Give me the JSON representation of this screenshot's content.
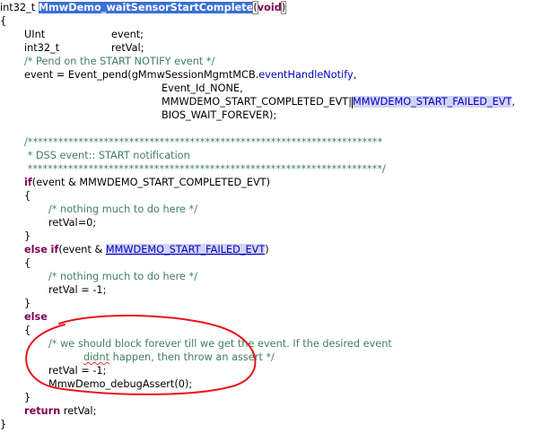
{
  "code": {
    "l01_type": "int32_t ",
    "l01_fname": "MmwDemo_waitSensorStartComplete",
    "l01_open": "(",
    "l01_void": "void",
    "l01_close": ")",
    "l02": "{",
    "l03_type": "UInt",
    "l03_var": "event;",
    "l04_type": "int32_t",
    "l04_var": "retVal;",
    "l05": "/* Pend on the START NOTIFY event */",
    "l06_a": "event = Event_pend(gMmwSessionMgmtMCB.",
    "l06_field": "eventHandleNotify",
    "l06_b": ",",
    "l07": "Event_Id_NONE,",
    "l08_a": "MMWDEMO_START_COMPLETED_EVT|",
    "l08_hl": "MMWDEMO_START_FAILED_EVT",
    "l08_b": ",",
    "l09": "BIOS_WAIT_FOREVER);",
    "l11": "/**********************************************************************",
    "l12": " * DSS event:: START notification",
    "l13": " **********************************************************************/",
    "l14_kw": "if",
    "l14_rest": "(event & MMWDEMO_START_COMPLETED_EVT)",
    "l15": "{",
    "l16": "/* nothing much to do here */",
    "l17": "retVal=0;",
    "l18": "}",
    "l19_kw1": "else",
    "l19_kw2": "if",
    "l19_a": "(event & ",
    "l19_hl": "MMWDEMO_START_FAILED_EVT",
    "l19_b": ")",
    "l20": "{",
    "l21": "/* nothing much to do here */",
    "l22": "retVal = -1;",
    "l23": "}",
    "l24_kw": "else",
    "l25": "{",
    "l26": "/* we should block forever till we get the event. If the desired event",
    "l27_a": "didnt",
    "l27_b": " happen, then throw an assert */",
    "l28": "retVal = -1;",
    "l29": "MmwDemo_debugAssert(0);",
    "l30": "}",
    "l31_kw": "return",
    "l31_rest": " retVal;",
    "l32": "}"
  },
  "colors": {
    "keyword": "#7f0055",
    "comment": "#3f7f5f",
    "selection": "#3a6fd6",
    "occurrence_highlight": "#d4d4f6",
    "annotation_circle": "#e8141c"
  }
}
